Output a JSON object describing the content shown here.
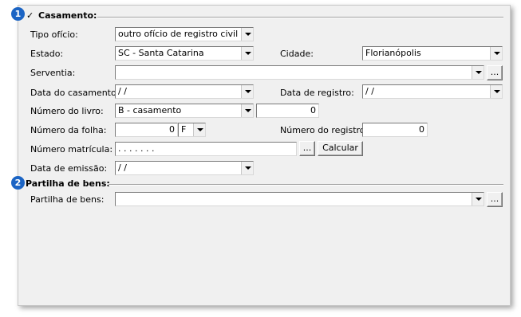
{
  "casamento": {
    "badge": "1",
    "title": "Casamento:",
    "checked": true,
    "tipo_oficio": {
      "label": "Tipo ofício:",
      "value": "outro ofício de registro civil"
    },
    "estado": {
      "label": "Estado:",
      "value": "SC - Santa Catarina"
    },
    "cidade": {
      "label": "Cidade:",
      "value": "Florianópolis"
    },
    "serventia": {
      "label": "Serventia:",
      "value": "",
      "browse_label": "..."
    },
    "data_casamento": {
      "label": "Data do casamento:",
      "value": " /  /"
    },
    "data_registro": {
      "label": "Data de registro:",
      "value": " /  /"
    },
    "numero_livro": {
      "label": "Número do livro:",
      "value": "B - casamento",
      "number": "0"
    },
    "numero_folha": {
      "label": "Número da folha:",
      "value": "0",
      "side": "F"
    },
    "numero_registro": {
      "label": "Número do registro:",
      "value": "0"
    },
    "numero_matricula": {
      "label": "Número matrícula:",
      "value": "    .    .    .    .    .    .    .",
      "browse_label": "...",
      "calc_label": "Calcular"
    },
    "data_emissao": {
      "label": "Data de emissão:",
      "value": " /  /"
    }
  },
  "partilha": {
    "badge": "2",
    "title": "Partilha de bens:",
    "field": {
      "label": "Partilha de bens:",
      "value": "",
      "browse_label": "..."
    }
  },
  "colors": {
    "badge": "#1b64c4",
    "panel": "#f0f0f0"
  }
}
